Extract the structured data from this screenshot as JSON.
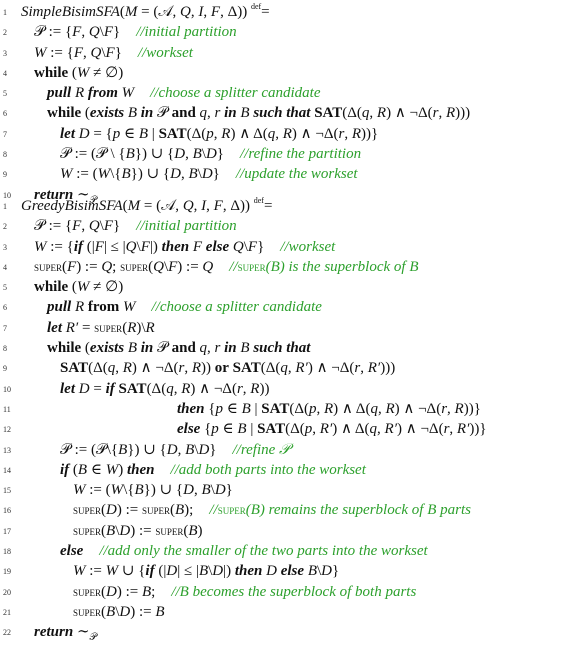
{
  "algorithms": [
    {
      "name": "SimpleBisimSFA",
      "lines": [
        {
          "n": "1",
          "indent": 0,
          "code": "SimpleBisimSFA(M = (𝒜, Q, I, F, Δ)) ≝",
          "comment": ""
        },
        {
          "n": "2",
          "indent": 1,
          "code": "𝒫 := {F, Q\\F}",
          "comment": "//initial partition"
        },
        {
          "n": "3",
          "indent": 1,
          "code": "W := {F, Q\\F}",
          "comment": "//workset"
        },
        {
          "n": "4",
          "indent": 1,
          "code": "while (W ≠ ∅)",
          "comment": ""
        },
        {
          "n": "5",
          "indent": 2,
          "code": "pull R from W",
          "comment": "//choose a splitter candidate"
        },
        {
          "n": "6",
          "indent": 2,
          "code": "while (exists B in 𝒫 and q, r in B such that SAT(Δ(q, R) ∧ ¬Δ(r, R)))",
          "comment": ""
        },
        {
          "n": "7",
          "indent": 3,
          "code": "let D = {p ∈ B | SAT(Δ(p, R) ∧ Δ(q, R) ∧ ¬Δ(r, R))}",
          "comment": ""
        },
        {
          "n": "8",
          "indent": 3,
          "code": "𝒫 := (𝒫 \\ {B}) ∪ {D, B\\D}",
          "comment": "//refine the partition"
        },
        {
          "n": "9",
          "indent": 3,
          "code": "W := (W\\{B}) ∪ {D, B\\D}",
          "comment": "//update the workset"
        },
        {
          "n": "10",
          "indent": 1,
          "code": "return ∼𝒫",
          "comment": ""
        }
      ]
    },
    {
      "name": "GreedyBisimSFA",
      "lines": [
        {
          "n": "1",
          "indent": 0,
          "code": "GreedyBisimSFA(M = (𝒜, Q, I, F, Δ)) ≝",
          "comment": ""
        },
        {
          "n": "2",
          "indent": 1,
          "code": "𝒫 := {F, Q\\F}",
          "comment": "//initial partition"
        },
        {
          "n": "3",
          "indent": 1,
          "code": "W := {if (|F| ≤ |Q\\F|) then F else Q\\F}",
          "comment": "//workset"
        },
        {
          "n": "4",
          "indent": 1,
          "code": "super(F) := Q; super(Q\\F) := Q",
          "comment": "//super(B) is the superblock of B"
        },
        {
          "n": "5",
          "indent": 1,
          "code": "while (W ≠ ∅)",
          "comment": ""
        },
        {
          "n": "6",
          "indent": 2,
          "code": "pull R from W",
          "comment": "//choose a splitter candidate"
        },
        {
          "n": "7",
          "indent": 2,
          "code": "let R′ = super(R)\\R",
          "comment": ""
        },
        {
          "n": "8",
          "indent": 2,
          "code": "while (exists B in 𝒫 and q, r in B such that",
          "comment": ""
        },
        {
          "n": "9",
          "indent": 3,
          "code": "SAT(Δ(q, R) ∧ ¬Δ(r, R)) or SAT(Δ(q, R′) ∧ ¬Δ(r, R′)))",
          "comment": ""
        },
        {
          "n": "10",
          "indent": 3,
          "code": "let D = if SAT(Δ(q, R) ∧ ¬Δ(r, R))",
          "comment": ""
        },
        {
          "n": "11",
          "indent": 5,
          "code": "then {p ∈ B | SAT(Δ(p, R) ∧ Δ(q, R) ∧ ¬Δ(r, R))}",
          "comment": ""
        },
        {
          "n": "12",
          "indent": 5,
          "code": "else {p ∈ B | SAT(Δ(p, R′) ∧ Δ(q, R′) ∧ ¬Δ(r, R′))}",
          "comment": ""
        },
        {
          "n": "13",
          "indent": 3,
          "code": "𝒫 := (𝒫\\{B}) ∪ {D, B\\D}",
          "comment": "//refine 𝒫"
        },
        {
          "n": "14",
          "indent": 3,
          "code": "if (B ∈ W) then",
          "comment": "//add both parts into the workset"
        },
        {
          "n": "15",
          "indent": 4,
          "code": "W := (W\\{B}) ∪ {D, B\\D}",
          "comment": ""
        },
        {
          "n": "16",
          "indent": 4,
          "code": "super(D) := super(B);",
          "comment": "//super(B) remains the superblock of B parts"
        },
        {
          "n": "17",
          "indent": 4,
          "code": "super(B\\D) := super(B)",
          "comment": ""
        },
        {
          "n": "18",
          "indent": 3,
          "code": "else",
          "comment": "//add only the smaller of the two parts into the workset"
        },
        {
          "n": "19",
          "indent": 4,
          "code": "W := W ∪ {if (|D| ≤ |B\\D|) then D else B\\D}",
          "comment": ""
        },
        {
          "n": "20",
          "indent": 4,
          "code": "super(D) := B;",
          "comment": "//B becomes the superblock of both parts"
        },
        {
          "n": "21",
          "indent": 4,
          "code": "super(B\\D) := B",
          "comment": ""
        },
        {
          "n": "22",
          "indent": 1,
          "code": "return ∼𝒫",
          "comment": ""
        }
      ]
    }
  ],
  "colors": {
    "text": "#111111",
    "comment": "#2ca02c",
    "line_number": "#333333"
  }
}
